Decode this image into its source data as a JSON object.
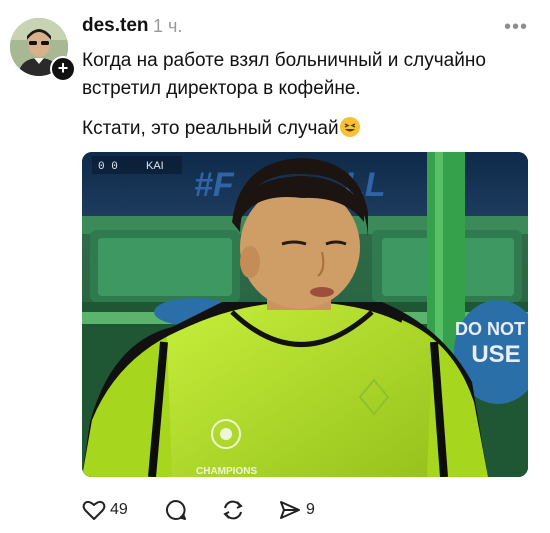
{
  "post": {
    "author": "des.ten",
    "time": "1 ч.",
    "more_label": "•••",
    "follow_symbol": "+",
    "text_lines": [
      "Когда на работе взял больничный и случайно",
      "встретил директора в кофейне."
    ],
    "text_line_3": "Кстати, это реальный случай",
    "emoji": "grinning-squinting-face"
  },
  "media": {
    "scoreboard": "0  0",
    "team": "KAI",
    "banner": "#F",
    "banner_tail": "LL",
    "sign": "DO NOT USE",
    "sign_top": "DO NOT",
    "sign_bottom": "USE",
    "vest_logo": "CHAMPIONS"
  },
  "actions": {
    "likes": "49",
    "reposts": "9"
  },
  "colors": {
    "text": "#111111",
    "muted": "#9a9a9a",
    "vest": "#b7e02a",
    "shirt": "#0f0f0f"
  }
}
